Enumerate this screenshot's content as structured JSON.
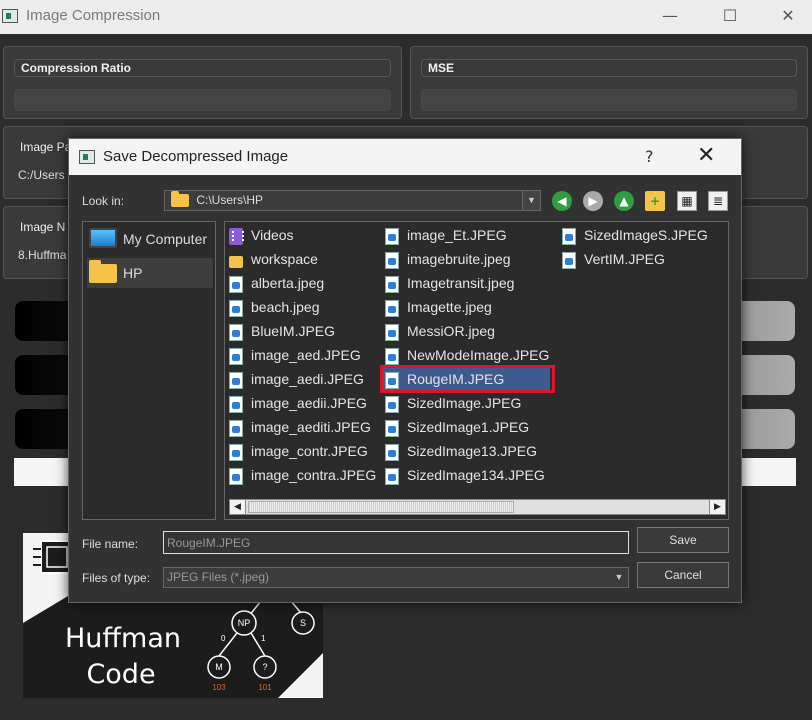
{
  "window": {
    "title": "Image Compression",
    "minimize": "—",
    "maximize": "☐",
    "close": "✕"
  },
  "panels": {
    "compression_ratio": {
      "title": "Compression Ratio",
      "value": ""
    },
    "mse": {
      "title": "MSE",
      "value": ""
    },
    "image_path": {
      "title": "Image Pa",
      "value": "C:/Users"
    },
    "image_name": {
      "title": "Image N",
      "value": "8.Huffma"
    }
  },
  "dialog": {
    "title": "Save Decompressed Image",
    "help": "?",
    "close": "✕",
    "look_in_label": "Look in:",
    "look_in_value": "C:\\Users\\HP",
    "sidebar": [
      {
        "label": "My Computer",
        "icon": "monitor-icon"
      },
      {
        "label": "HP",
        "icon": "folder-icon"
      }
    ],
    "files": [
      {
        "name": "Videos",
        "type": "video-folder"
      },
      {
        "name": "workspace",
        "type": "folder"
      },
      {
        "name": "alberta.jpeg",
        "type": "image"
      },
      {
        "name": "beach.jpeg",
        "type": "image"
      },
      {
        "name": "BlueIM.JPEG",
        "type": "image"
      },
      {
        "name": "image_aed.JPEG",
        "type": "image"
      },
      {
        "name": "image_aedi.JPEG",
        "type": "image"
      },
      {
        "name": "image_aedii.JPEG",
        "type": "image"
      },
      {
        "name": "image_aediti.JPEG",
        "type": "image"
      },
      {
        "name": "image_contr.JPEG",
        "type": "image"
      },
      {
        "name": "image_contra.JPEG",
        "type": "image"
      },
      {
        "name": "image_Et.JPEG",
        "type": "image"
      },
      {
        "name": "imagebruite.jpeg",
        "type": "image"
      },
      {
        "name": "Imagetransit.jpeg",
        "type": "image"
      },
      {
        "name": "Imagette.jpeg",
        "type": "image"
      },
      {
        "name": "MessiOR.jpeg",
        "type": "image"
      },
      {
        "name": "NewModeImage.JPEG",
        "type": "image"
      },
      {
        "name": "RougeIM.JPEG",
        "type": "image",
        "selected": true
      },
      {
        "name": "SizedImage.JPEG",
        "type": "image"
      },
      {
        "name": "SizedImage1.JPEG",
        "type": "image"
      },
      {
        "name": "SizedImage13.JPEG",
        "type": "image"
      },
      {
        "name": "SizedImage134.JPEG",
        "type": "image"
      },
      {
        "name": "SizedImageS.JPEG",
        "type": "image"
      },
      {
        "name": "VertIM.JPEG",
        "type": "image"
      }
    ],
    "file_name_label": "File name:",
    "file_name_value": "RougeIM.JPEG",
    "file_type_label": "Files of type:",
    "file_type_value": "JPEG Files (*.jpeg)",
    "save_button": "Save",
    "cancel_button": "Cancel"
  },
  "logo": {
    "line1": "Huffman",
    "line2": "Code",
    "tree_nodes": [
      "NP",
      "S",
      "M",
      "?"
    ],
    "tree_edge_labels": [
      "0",
      "1"
    ],
    "tree_codes": [
      "103",
      "101"
    ]
  },
  "colors": {
    "selection_box": "#d9162c",
    "selection_fill": "#3f5a8f",
    "folder": "#f5c24a"
  }
}
